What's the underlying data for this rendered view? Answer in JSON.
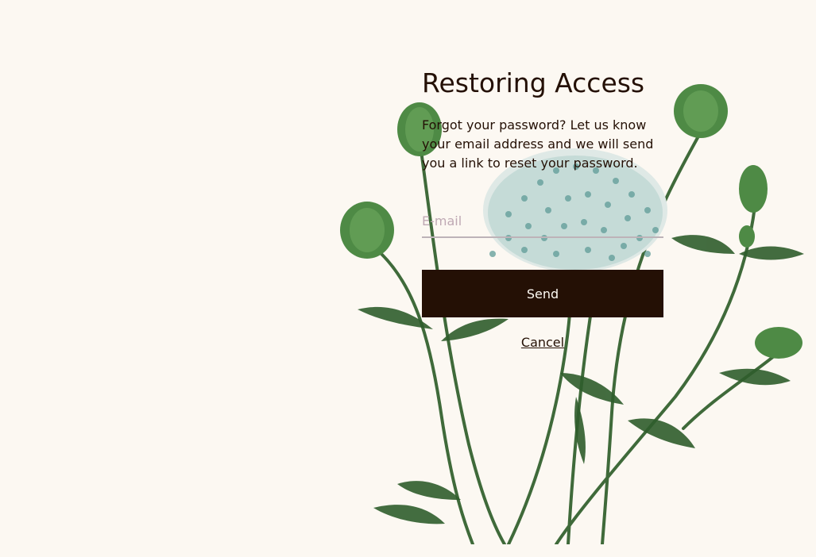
{
  "page": {
    "title": "Restoring Access",
    "description": "Forgot your password? Let us know your email address and we will send you a link to reset your password."
  },
  "form": {
    "email_placeholder": "E-mail",
    "email_value": "",
    "send_label": "Send",
    "cancel_label": "Cancel"
  },
  "colors": {
    "background": "#fcf8f2",
    "text": "#241005",
    "button": "#241005",
    "button_text": "#fcf8f2",
    "placeholder": "#bfa9b4",
    "stem": "#3f6a3a",
    "bud": "#4e8a45",
    "flower": "#9fc6c3"
  },
  "illustration": {
    "icon": "botanical-flowers-illustration"
  }
}
